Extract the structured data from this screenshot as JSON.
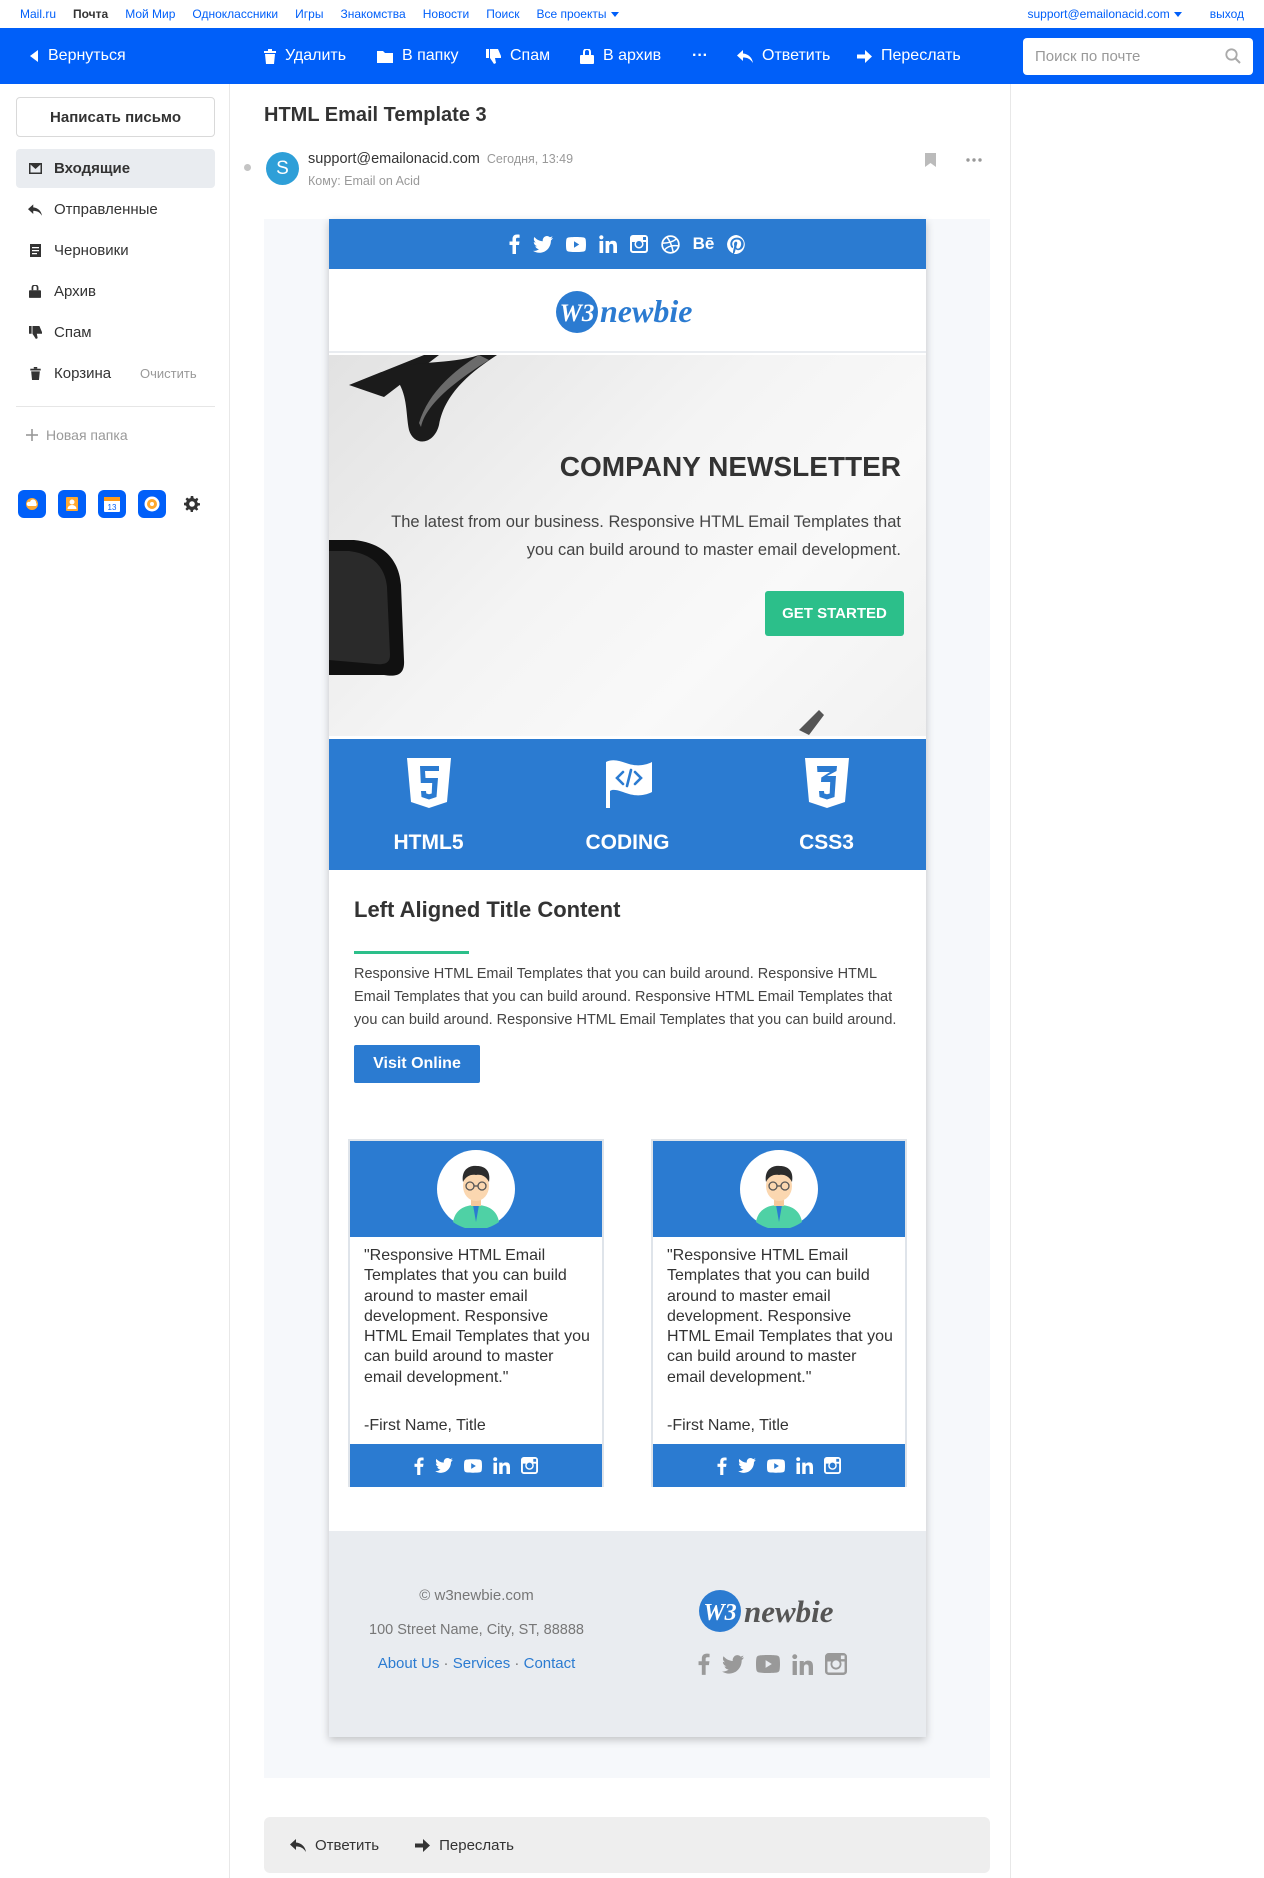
{
  "portal": {
    "links": [
      "Mail.ru",
      "Почта",
      "Мой Мир",
      "Одноклассники",
      "Игры",
      "Знакомства",
      "Новости",
      "Поиск",
      "Все проекты"
    ],
    "account": "support@emailonacid.com",
    "logout": "выход"
  },
  "toolbar": {
    "back": "Вернуться",
    "delete": "Удалить",
    "move": "В папку",
    "spam": "Спам",
    "archive": "В архив",
    "more": "···",
    "reply": "Ответить",
    "forward": "Переслать",
    "search_placeholder": "Поиск по почте"
  },
  "sidebar": {
    "compose": "Написать письмо",
    "folders": [
      {
        "label": "Входящие",
        "icon": "inbox-icon",
        "active": true
      },
      {
        "label": "Отправленные",
        "icon": "sent-icon"
      },
      {
        "label": "Черновики",
        "icon": "drafts-icon"
      },
      {
        "label": "Архив",
        "icon": "archive-icon"
      },
      {
        "label": "Спам",
        "icon": "spam-icon"
      },
      {
        "label": "Корзина",
        "icon": "trash-icon",
        "extra": "Очистить"
      }
    ],
    "new_folder": "Новая папка",
    "apps": [
      "cloud-icon",
      "contacts-icon",
      "calendar-icon",
      "games-icon",
      "settings-icon"
    ],
    "calendar_day": "13"
  },
  "message": {
    "subject": "HTML Email Template 3",
    "avatar_letter": "S",
    "from": "support@emailonacid.com",
    "time": "Сегодня, 13:49",
    "to": "Кому: Email on Acid"
  },
  "email": {
    "logo": {
      "prefix": "W3",
      "name": "newbie"
    },
    "hero": {
      "title": "COMPANY NEWSLETTER",
      "text": "The latest from our business. Responsive HTML Email Templates that you can build around to master email development.",
      "cta": "GET STARTED"
    },
    "features": [
      "HTML5",
      "CODING",
      "CSS3"
    ],
    "content": {
      "title": "Left Aligned Title Content",
      "text": "Responsive HTML Email Templates that you can build around. Responsive HTML Email Templates that you can build around. Responsive HTML Email Templates that you can build around. Responsive HTML Email Templates that you can build around.",
      "button": "Visit Online"
    },
    "testimonials": [
      {
        "quote": "\"Responsive HTML Email Templates that you can build around to master email development. Responsive HTML Email Templates that you can build around to master email development.\"",
        "sign": "-First Name, Title"
      },
      {
        "quote": "\"Responsive HTML Email Templates that you can build around to master email development. Responsive HTML Email Templates that you can build around to master email development.\"",
        "sign": "-First Name, Title"
      }
    ],
    "footer": {
      "copyright": "© w3newbie.com",
      "address": "100 Street Name, City, ST, 88888",
      "links": [
        "About Us",
        "Services",
        "Contact"
      ],
      "link_sep": " · "
    },
    "social_icons": [
      "facebook-icon",
      "twitter-icon",
      "youtube-icon",
      "linkedin-icon",
      "instagram-icon",
      "dribbble-icon",
      "behance-icon",
      "pinterest-icon"
    ],
    "behance_text": "Bē"
  },
  "reply_bar": {
    "reply": "Ответить",
    "forward": "Переслать"
  },
  "colors": {
    "accent": "#005ff9",
    "email_blue": "#2b7bd1",
    "email_green": "#2cbf8a",
    "sidebar_active": "#e9ecf0"
  }
}
